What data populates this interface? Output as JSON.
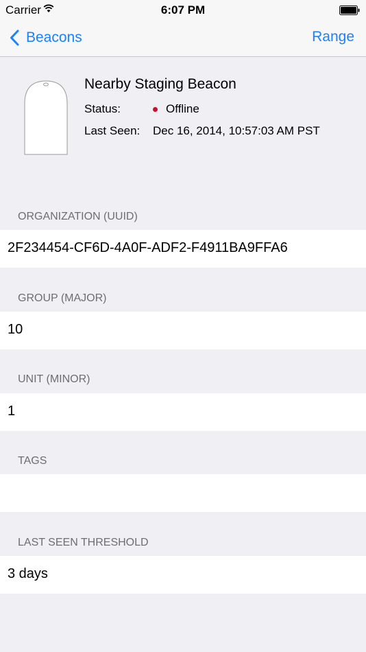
{
  "status_bar": {
    "carrier": "Carrier",
    "time": "6:07 PM",
    "wifi_icon": "wifi-icon",
    "battery_icon": "battery-icon"
  },
  "nav": {
    "back_label": "Beacons",
    "back_icon": "chevron-left-icon",
    "right_label": "Range"
  },
  "beacon": {
    "name": "Nearby Staging Beacon",
    "status_label": "Status:",
    "status_value": "Offline",
    "status_color": "#c8102e",
    "last_seen_label": "Last Seen:",
    "last_seen_value": "Dec 16, 2014, 10:57:03 AM PST"
  },
  "sections": [
    {
      "header": "ORGANIZATION (UUID)",
      "value": "2F234454-CF6D-4A0F-ADF2-F4911BA9FFA6"
    },
    {
      "header": "GROUP (MAJOR)",
      "value": "10"
    },
    {
      "header": "UNIT (MINOR)",
      "value": "1"
    },
    {
      "header": "TAGS",
      "value": ""
    },
    {
      "header": "LAST SEEN THRESHOLD",
      "value": "3 days"
    }
  ],
  "colors": {
    "accent": "#1a82fb",
    "background": "#efeff4",
    "section_header_text": "#6d6d72"
  }
}
